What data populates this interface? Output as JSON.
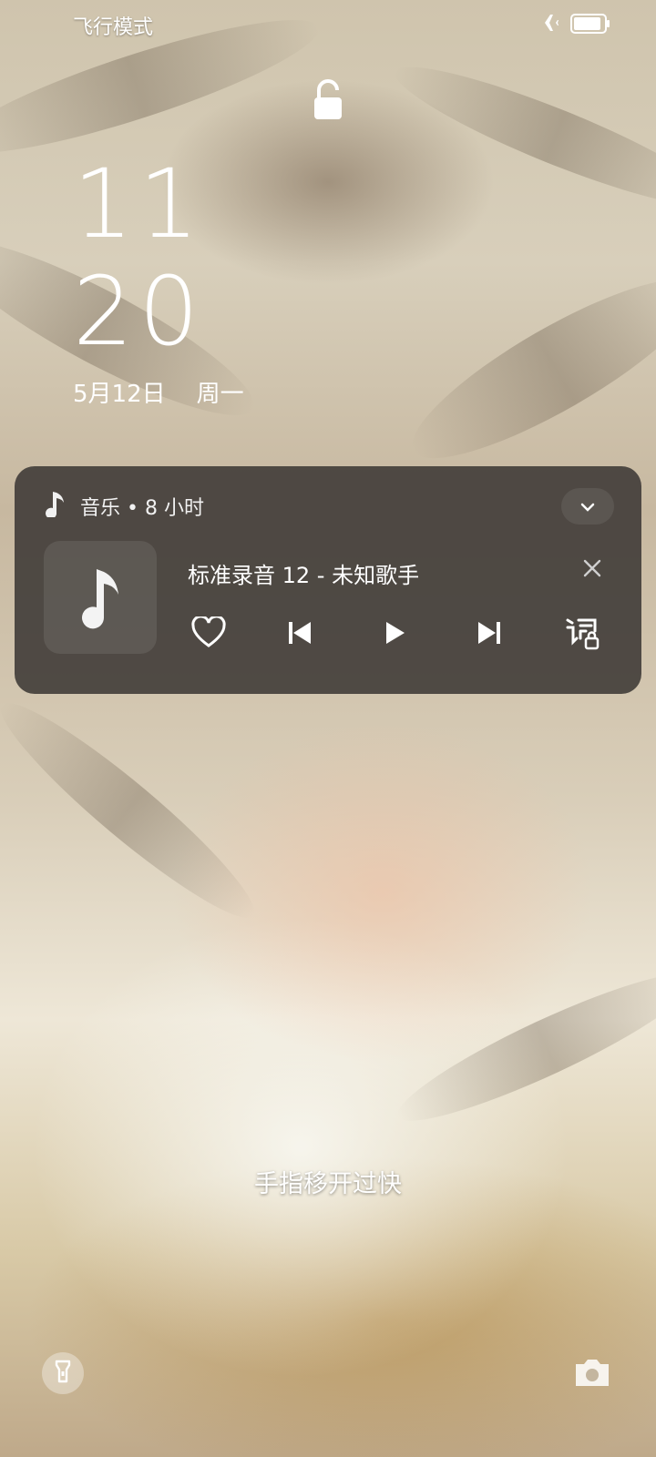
{
  "status": {
    "mode_text": "飞行模式",
    "battery_percent": 90,
    "icons": [
      "airplane-icon",
      "battery-icon"
    ]
  },
  "lockscreen": {
    "lock_icon": "padlock-icon",
    "time_hour": "11",
    "time_minute": "20",
    "date": "5月12日",
    "weekday": "周一"
  },
  "media_card": {
    "app_name": "音乐",
    "elapsed": "• 8 小时",
    "track": "标准录音 12 - 未知歌手",
    "icons": [
      "music-note-icon",
      "chevron-down-icon",
      "close-icon",
      "heart-icon",
      "previous-icon",
      "play-icon",
      "next-icon",
      "lyrics-icon"
    ]
  },
  "toast": {
    "message": "手指移开过快"
  },
  "shortcuts": {
    "left": "flashlight-icon",
    "right": "camera-icon"
  },
  "colors": {
    "card_bg": "#403c39",
    "text": "#ffffff"
  }
}
